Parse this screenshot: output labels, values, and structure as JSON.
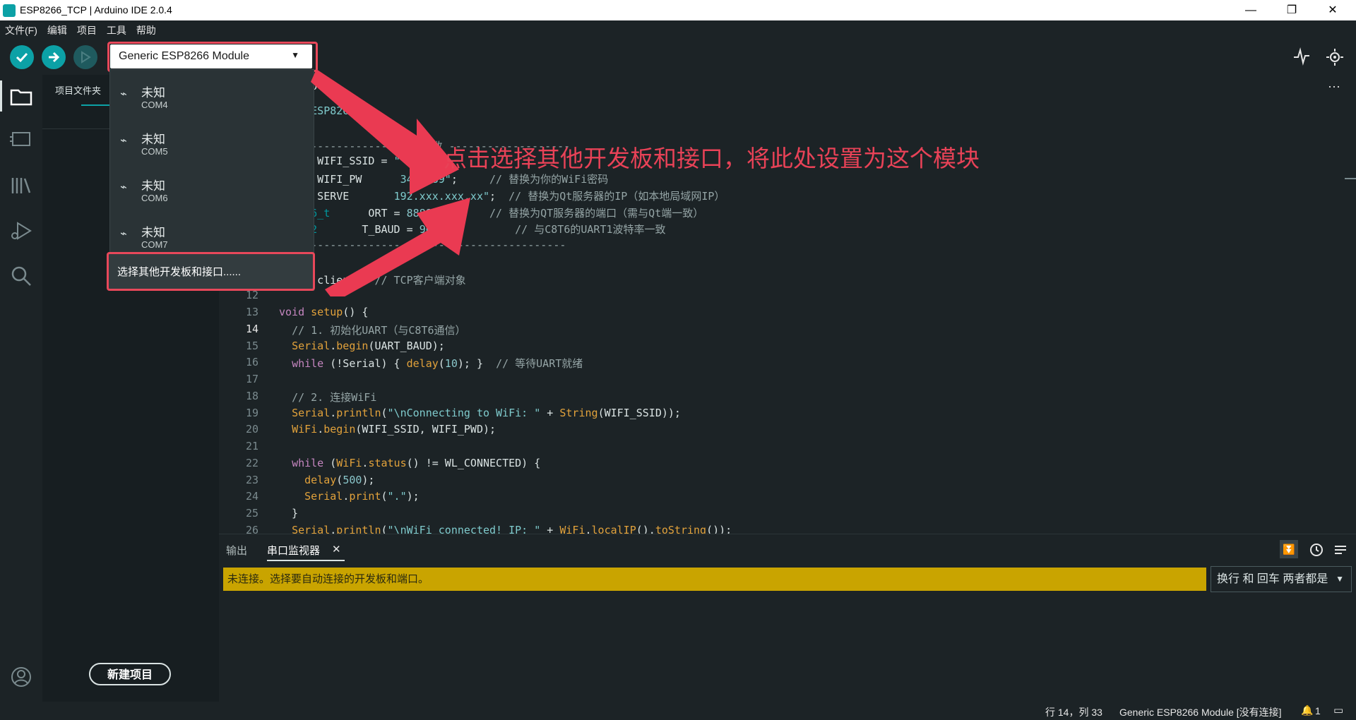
{
  "window": {
    "title": "ESP8266_TCP | Arduino IDE 2.0.4",
    "minimize": "—",
    "restore": "❐",
    "close": "✕"
  },
  "menu": [
    "文件(F)",
    "编辑",
    "项目",
    "工具",
    "帮助"
  ],
  "board_select": {
    "label": "Generic ESP8266 Module"
  },
  "sidebar": {
    "header": "项目文件夹",
    "new_project": "新建项目"
  },
  "editor": {
    "tab_label": "o",
    "more": "···"
  },
  "ports": [
    {
      "name": "未知",
      "port": "COM4"
    },
    {
      "name": "未知",
      "port": "COM5"
    },
    {
      "name": "未知",
      "port": "COM6"
    },
    {
      "name": "未知",
      "port": "COM7"
    }
  ],
  "other_board": "选择其他开发板和接口......",
  "annotation": "点击选择其他开发板和接口，将此处设置为这个模块",
  "code_lines": [
    {
      "n": "",
      "html": "<span class=\"kw\">ude</span> <span class=\"st\">&lt;ESP826</span>"
    },
    {
      "n": "",
      "html": ""
    },
    {
      "n": "",
      "html": "<span class=\"cm\">------------------ 配置参数 -------------------</span>"
    },
    {
      "n": "",
      "html": "<span class=\"ty\">char</span>* WIFI_SSID = <span class=\"st\">\"</span>"
    },
    {
      "n": "",
      "html": "<span class=\"ty\">char</span>* WIFI_PW      <span class=\"st\">3456789\"</span>;     <span class=\"cm\">// 替换为你的WiFi密码</span>"
    },
    {
      "n": "",
      "html": "<span class=\"ty\">char</span>* SERVE       <span class=\"st\">192.xxx.xxx.xx\"</span>;  <span class=\"cm\">// 替换为Qt服务器的IP（如本地局域网IP）</span>"
    },
    {
      "n": "",
      "html": "<span class=\"ty\">uint16_t</span>      ORT = <span class=\"nm\">8888</span>;        <span class=\"cm\">// 替换为QT服务器的端口（需与Qt端一致）</span>"
    },
    {
      "n": "",
      "html": "<span class=\"ty\">uint32</span>       T_BAUD = <span class=\"nm\">9600</span>;          <span class=\"cm\">// 与C8T6的UART1波特率一致</span>"
    },
    {
      "n": "",
      "html": "<span class=\"cm\">---------------------------------------------</span>"
    },
    {
      "n": "",
      "html": ""
    },
    {
      "n": "",
      "html": "lient client;  <span class=\"cm\">// TCP客户端对象</span>"
    },
    {
      "n": "12",
      "html": ""
    },
    {
      "n": "13",
      "html": "<span class=\"kw\">void</span> <span class=\"orange\">setup</span>() {"
    },
    {
      "n": "14",
      "html": "  <span class=\"cm\">// 1. 初始化UART（与C8T6通信）</span>"
    },
    {
      "n": "15",
      "html": "  <span class=\"orange\">Serial</span>.<span class=\"orange\">begin</span>(UART_BAUD);"
    },
    {
      "n": "16",
      "html": "  <span class=\"kw\">while</span> (!Serial) { <span class=\"orange\">delay</span>(<span class=\"nm\">10</span>); }  <span class=\"cm\">// 等待UART就绪</span>"
    },
    {
      "n": "17",
      "html": ""
    },
    {
      "n": "18",
      "html": "  <span class=\"cm\">// 2. 连接WiFi</span>"
    },
    {
      "n": "19",
      "html": "  <span class=\"orange\">Serial</span>.<span class=\"orange\">println</span>(<span class=\"st\">\"\\nConnecting to WiFi: \"</span> + <span class=\"orange\">String</span>(WIFI_SSID));"
    },
    {
      "n": "20",
      "html": "  <span class=\"orange\">WiFi</span>.<span class=\"orange\">begin</span>(WIFI_SSID, WIFI_PWD);"
    },
    {
      "n": "21",
      "html": ""
    },
    {
      "n": "22",
      "html": "  <span class=\"kw\">while</span> (<span class=\"orange\">WiFi</span>.<span class=\"orange\">status</span>() != WL_CONNECTED) {"
    },
    {
      "n": "23",
      "html": "    <span class=\"orange\">delay</span>(<span class=\"nm\">500</span>);"
    },
    {
      "n": "24",
      "html": "    <span class=\"orange\">Serial</span>.<span class=\"orange\">print</span>(<span class=\"st\">\".\"</span>);"
    },
    {
      "n": "25",
      "html": "  }"
    },
    {
      "n": "26",
      "html": "  <span class=\"orange\">Serial</span>.<span class=\"orange\">println</span>(<span class=\"st\">\"\\nWiFi connected! IP: \"</span> + <span class=\"orange\">WiFi</span>.<span class=\"orange\">localIP</span>().<span class=\"orange\">toString</span>());"
    }
  ],
  "panel": {
    "tab_output": "输出",
    "tab_serial": "串口监视器",
    "tab_close": "✕",
    "warning": "未连接。选择要自动连接的开发板和端口。",
    "line_ending": "换行 和 回车 两者都是"
  },
  "status": {
    "position": "行 14，列 33",
    "board": "Generic ESP8266 Module [没有连接]",
    "notifications": "1"
  }
}
